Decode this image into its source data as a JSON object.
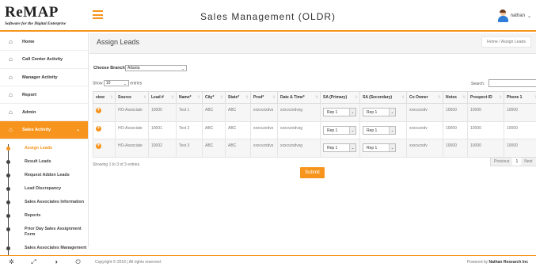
{
  "header": {
    "logo_main": "ReMAP",
    "logo_sub": "Software for the Digital Enterprise",
    "app_title": "Sales Management (OLDR)",
    "user_name": "nathan"
  },
  "sidebar": {
    "items": [
      {
        "label": "Home",
        "icon": "home-icon"
      },
      {
        "label": "Call Center Activity",
        "icon": "home-icon"
      },
      {
        "label": "Manager Activity",
        "icon": "home-icon"
      },
      {
        "label": "Report",
        "icon": "home-icon"
      },
      {
        "label": "Admin",
        "icon": "home-icon"
      },
      {
        "label": "Sales Activity",
        "icon": "home-icon",
        "active": true
      }
    ],
    "subitems": [
      {
        "label": "Assign Leads",
        "current": true
      },
      {
        "label": "Result Leads"
      },
      {
        "label": "Request Addon Leads"
      },
      {
        "label": "Lead Discrepancy"
      },
      {
        "label": "Sales Associates Information"
      },
      {
        "label": "Reports"
      },
      {
        "label": "Prior Day Sales Assignment Form"
      },
      {
        "label": "Sales Associates Management"
      }
    ]
  },
  "page": {
    "title": "Assign Leads",
    "breadcrumb": "Home  /  Assign Leads"
  },
  "filters": {
    "branch_label": "Choose Branch",
    "branch_value": "Atlanta",
    "show_label": "Show",
    "show_value": "10",
    "entries_label": "entries",
    "search_label": "Search:"
  },
  "table": {
    "columns": [
      "view",
      "Source",
      "Lead #",
      "Name*",
      "City*",
      "State*",
      "Prod*",
      "Date & Time*",
      "SA (Primary)",
      "SA (Secondary)",
      "Co Owner",
      "Notes",
      "Prospect ID",
      "Phone 1"
    ],
    "rows": [
      [
        "",
        "HO-Associate",
        "10000",
        "Test 1",
        "ABC",
        "ABC",
        "xxxcvzxdvs",
        "xxxcvzxdvsg",
        "Rep 1",
        "Rep 1",
        "xxxcvzxdv",
        "10000",
        "10000",
        "10000"
      ],
      [
        "",
        "HO-Associate",
        "10001",
        "Test 2",
        "ABC",
        "ABC",
        "xxxcvzxdvs",
        "xxxcvzxdvsg",
        "Rep 1",
        "Rep 1",
        "xxxcvzxdv",
        "10000",
        "10000",
        "10000"
      ],
      [
        "",
        "HO-Associate",
        "10002",
        "Test 3",
        "ABC",
        "ABC",
        "xxxcvzxdvs",
        "xxxcvzxdvsg",
        "Rep 1",
        "Rep 1",
        "xxxcvzxdv",
        "10000",
        "10000",
        "10000"
      ]
    ],
    "info": "Showing 1 to 3 of 3 entries",
    "pager": {
      "prev": "Previous",
      "page": "1",
      "next": "Next"
    }
  },
  "actions": {
    "submit": "Submit"
  },
  "footer": {
    "copyright": "Copyright © 2016 | All rights reserved.",
    "powered_prefix": "Powered by",
    "powered_by": "Nathan Research Inc"
  },
  "colors": {
    "accent": "#f7941d"
  }
}
